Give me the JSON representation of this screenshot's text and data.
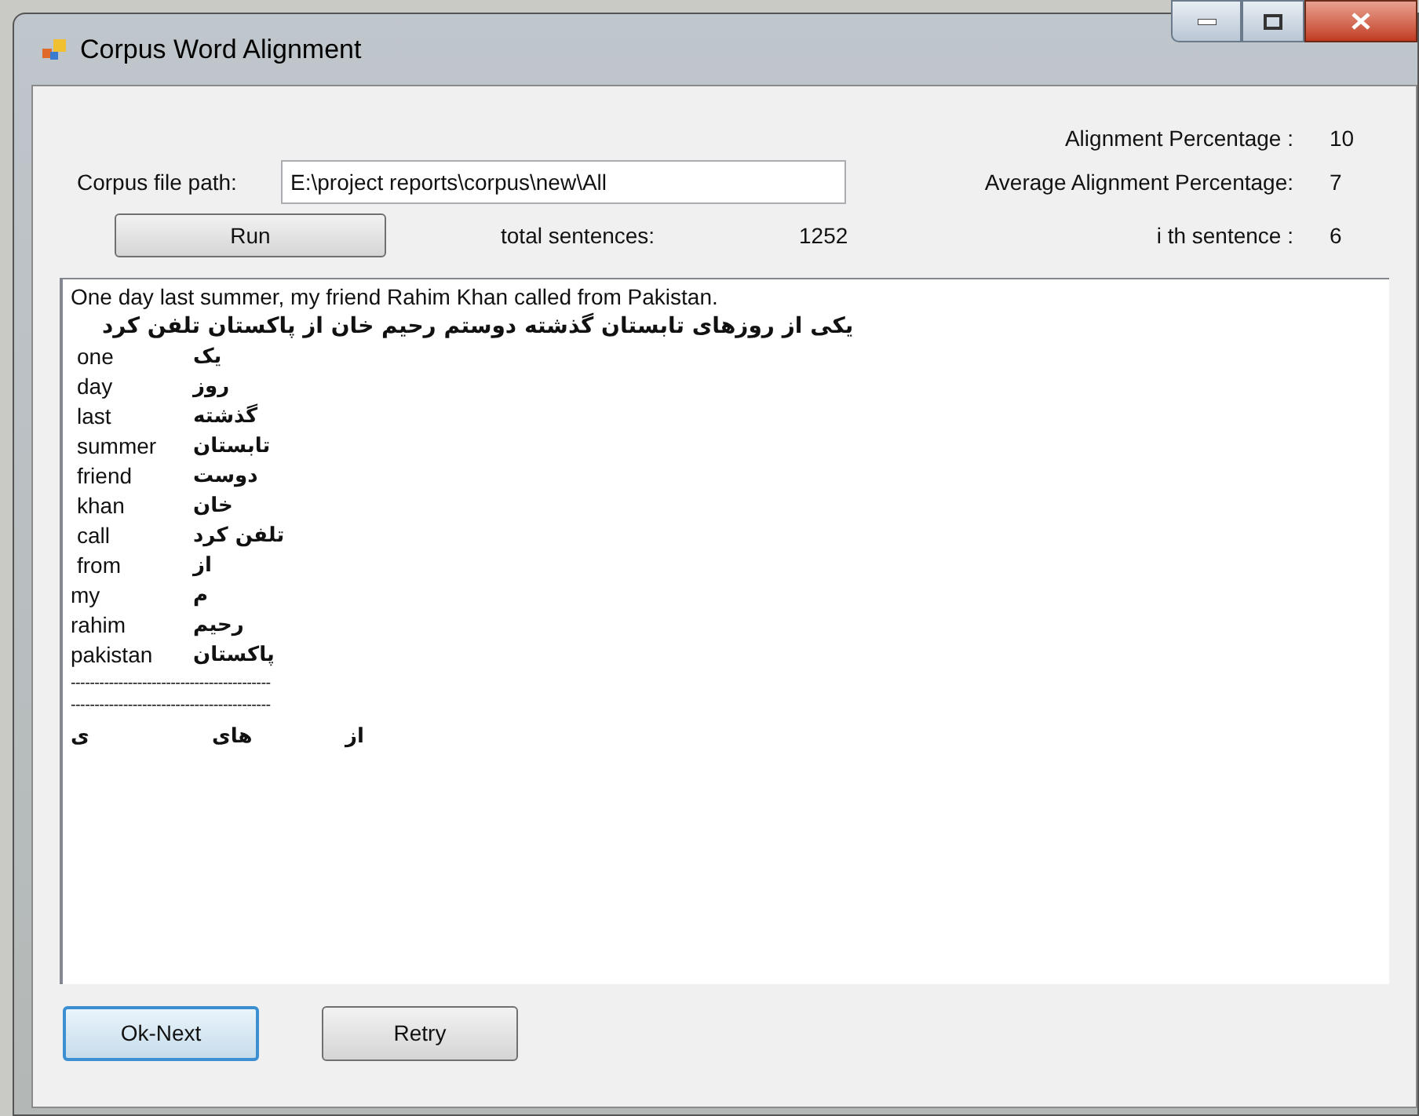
{
  "window": {
    "title": "Corpus Word Alignment"
  },
  "stats": [
    {
      "label": "Alignment Percentage :",
      "value": "10"
    },
    {
      "label": "Average Alignment Percentage:",
      "value": "7"
    },
    {
      "label": "i th sentence :",
      "value": "6"
    }
  ],
  "corpus_path": {
    "label": "Corpus file path:",
    "value": "E:\\project reports\\corpus\\new\\All"
  },
  "run_button": "Run",
  "total_sentences": {
    "label": "total sentences:",
    "value": "1252"
  },
  "output": {
    "sentence": "One day last summer, my friend Rahim Khan called from Pakistan.",
    "translation": "یکی از روزهای تابستان  گذشته دوستم رحیم خان از پاکستان تلفن  کرد",
    "pairs": [
      {
        "english": "one",
        "persian": "یک",
        "indented": true
      },
      {
        "english": "day",
        "persian": "روز",
        "indented": true
      },
      {
        "english": "last",
        "persian": "گذشته",
        "indented": true
      },
      {
        "english": "summer",
        "persian": "تابستان",
        "indented": true
      },
      {
        "english": "friend",
        "persian": "دوست",
        "indented": true
      },
      {
        "english": "khan",
        "persian": "خان",
        "indented": true
      },
      {
        "english": "call",
        "persian": "تلفن کرد",
        "indented": true
      },
      {
        "english": "from",
        "persian": "از",
        "indented": true
      },
      {
        "english": "my",
        "persian": "م",
        "indented": false
      },
      {
        "english": "rahim",
        "persian": "رحیم",
        "indented": false
      },
      {
        "english": "pakistan",
        "persian": "پاکستان",
        "indented": false
      }
    ],
    "separators": [
      "------------------------------------------",
      "------------------------------------------"
    ],
    "leftover": [
      "از",
      "های",
      "ی"
    ]
  },
  "buttons": [
    {
      "label": "Ok-Next",
      "default": true
    },
    {
      "label": "Retry",
      "default": false
    }
  ]
}
